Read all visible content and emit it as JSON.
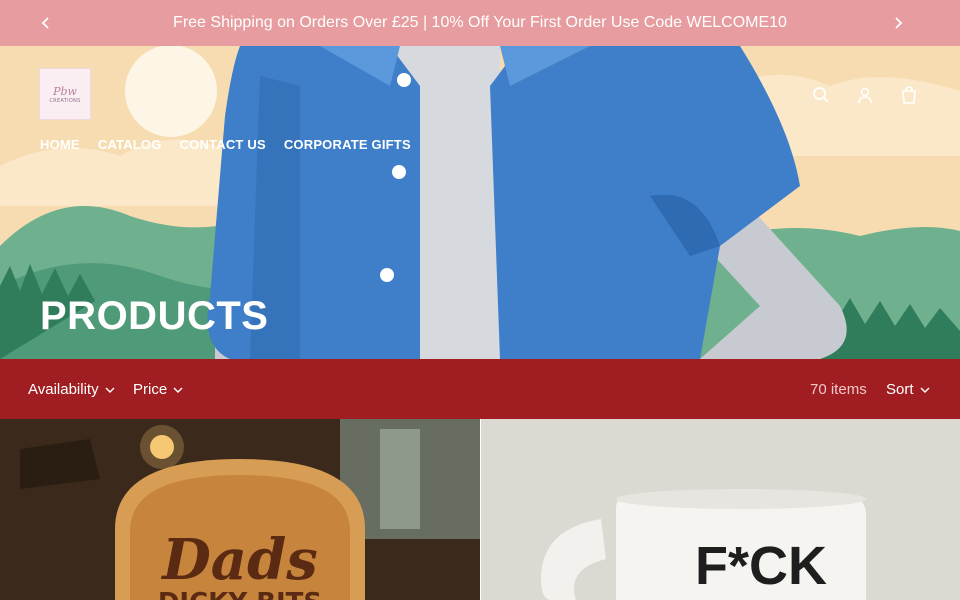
{
  "announcement": {
    "text": "Free Shipping on Orders Over £25 | 10% Off Your First Order Use Code WELCOME10"
  },
  "logo": {
    "script": "Pbw",
    "sub": "CREATIONS"
  },
  "nav": {
    "items": [
      "HOME",
      "CATALOG",
      "CONTACT US",
      "CORPORATE GIFTS"
    ]
  },
  "header_icons": [
    "search-icon",
    "account-icon",
    "cart-icon"
  ],
  "page_title": "PRODUCTS",
  "filters": {
    "availability": "Availability",
    "price": "Price",
    "items_count": "70 items",
    "sort": "Sort"
  },
  "products": [
    {
      "image_text_1": "Dads",
      "image_text_2": "DICKY BITS"
    },
    {
      "image_text": "F*CK"
    }
  ],
  "colors": {
    "announcement_bg": "#e79c9f",
    "filterbar_bg": "#a01e22",
    "hero_sky": "#f7dcb2",
    "jacket_blue": "#3f7fc9"
  }
}
